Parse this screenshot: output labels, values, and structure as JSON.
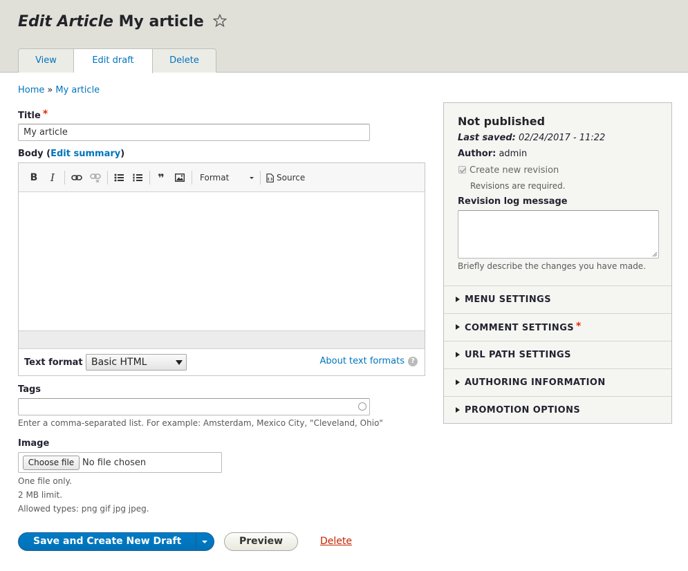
{
  "header": {
    "title_prefix": "Edit Article",
    "title_name": "My article",
    "tabs": [
      {
        "label": "View"
      },
      {
        "label": "Edit draft"
      },
      {
        "label": "Delete"
      }
    ]
  },
  "breadcrumb": {
    "home": "Home",
    "separator": "»",
    "current": "My article"
  },
  "form": {
    "title_label": "Title",
    "title_value": "My article",
    "required_mark": "*",
    "body_label": "Body",
    "body_paren_open": "(",
    "edit_summary_link": "Edit summary",
    "body_paren_close": ")",
    "toolbar": {
      "bold": "B",
      "italic": "I",
      "blockquote": "❞",
      "format_label": "Format",
      "source_label": "Source"
    },
    "text_format_label": "Text format",
    "text_format_value": "Basic HTML",
    "about_text_formats": "About text formats",
    "help_glyph": "?",
    "tags_label": "Tags",
    "tags_description": "Enter a comma-separated list. For example: Amsterdam, Mexico City, \"Cleveland, Ohio\"",
    "image_label": "Image",
    "choose_file": "Choose file",
    "no_file": "No file chosen",
    "image_desc": [
      "One file only.",
      "2 MB limit.",
      "Allowed types: png gif jpg jpeg."
    ]
  },
  "actions": {
    "save": "Save and Create New Draft",
    "preview": "Preview",
    "delete": "Delete"
  },
  "sidebar": {
    "status": "Not published",
    "last_saved_label": "Last saved:",
    "last_saved_value": "02/24/2017 - 11:22",
    "author_label": "Author:",
    "author_value": "admin",
    "new_revision": "Create new revision",
    "revisions_required": "Revisions are required.",
    "revision_log_label": "Revision log message",
    "revision_log_desc": "Briefly describe the changes you have made.",
    "sections": [
      {
        "label": "MENU SETTINGS"
      },
      {
        "label": "COMMENT SETTINGS",
        "required": "*"
      },
      {
        "label": "URL PATH SETTINGS"
      },
      {
        "label": "AUTHORING INFORMATION"
      },
      {
        "label": "PROMOTION OPTIONS"
      }
    ]
  },
  "colors": {
    "link": "#0074bd",
    "primary_button": "#0071b8",
    "header_bg": "#e0e0d8",
    "required": "#e62600",
    "delete_link": "#c72100"
  }
}
